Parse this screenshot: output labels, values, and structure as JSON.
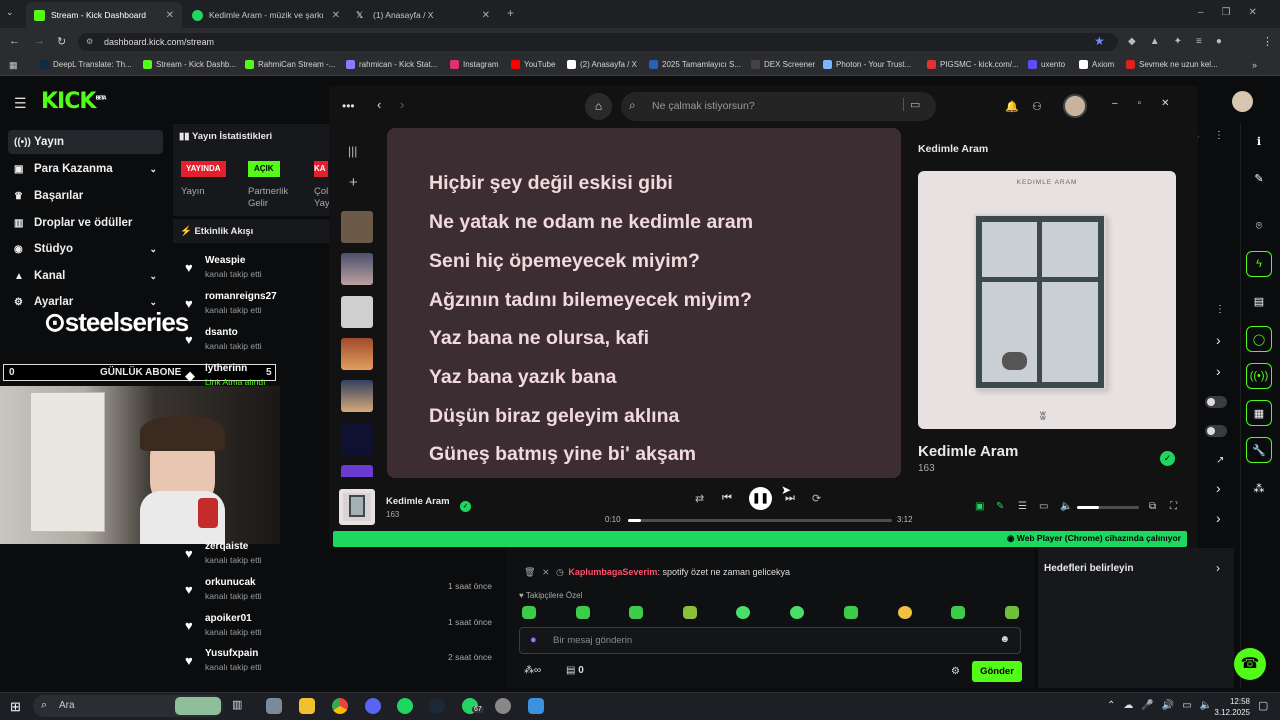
{
  "browser": {
    "tabs": [
      {
        "title": "Stream - Kick Dashboard",
        "color": "#53fc18"
      },
      {
        "title": "Kedimle Aram - müzik ve şarkı",
        "color": "#1ed760"
      },
      {
        "title": "(1) Anasayfa / X",
        "color": "#ffffff"
      }
    ],
    "url": "dashboard.kick.com/stream",
    "bookmarks": [
      "DeepL Translate: Th...",
      "Stream - Kick Dashb...",
      "RahmiCan Stream -...",
      "rahmican - Kick Stat...",
      "Instagram",
      "YouTube",
      "(2) Anasayfa / X",
      "2025 Tamamlayıcı S...",
      "DEX Screener",
      "Photon - Your Trust...",
      "PIGSMC - kick.com/...",
      "uxento",
      "Axiom",
      "Sevmek ne uzun kel..."
    ]
  },
  "kick": {
    "logo": "KICK",
    "logo_sup": "BETA",
    "sidebar": [
      {
        "label": "Yayın",
        "icon": "broadcast-icon"
      },
      {
        "label": "Para Kazanma",
        "icon": "money-icon"
      },
      {
        "label": "Başarılar",
        "icon": "trophy-icon"
      },
      {
        "label": "Droplar ve ödüller",
        "icon": "gift-icon"
      },
      {
        "label": "Stüdyo",
        "icon": "studio-icon"
      },
      {
        "label": "Kanal",
        "icon": "channel-icon"
      },
      {
        "label": "Ayarlar",
        "icon": "gear-icon"
      }
    ],
    "stats_title": "Yayın İstatistikleri",
    "stat_badges": [
      {
        "badge": "YAYINDA",
        "label": "Yayın",
        "color": "#e5202e"
      },
      {
        "badge": "AÇIK",
        "label": "Partnerlik Gelir",
        "color": "#53fc18"
      },
      {
        "badge": "KA",
        "label": "Çol Yay",
        "color": "#e5202e"
      }
    ],
    "activity_title": "Etkinlik Akışı",
    "feed": [
      {
        "name": "Weaspie",
        "sub": "kanalı takip etti",
        "time": ""
      },
      {
        "name": "romanreigns27",
        "sub": "kanalı takip etti",
        "time": ""
      },
      {
        "name": "dsanto",
        "sub": "kanalı takip etti",
        "time": ""
      },
      {
        "name": "lytherinn",
        "sub": "Link Atma alındı",
        "time": ""
      },
      {
        "name": "zerqaiste",
        "sub": "kanalı takip etti",
        "time": ""
      },
      {
        "name": "orkunucak",
        "sub": "kanalı takip etti",
        "time": "1 saat önce"
      },
      {
        "name": "apoiker01",
        "sub": "kanalı takip etti",
        "time": "1 saat önce"
      },
      {
        "name": "Yusufxpain",
        "sub": "kanalı takip etti",
        "time": "2 saat önce"
      }
    ],
    "overlay": {
      "brand": "steelseries",
      "counter_left": "0",
      "counter_label": "GÜNLÜK ABONE",
      "counter_right": "5"
    },
    "chat": {
      "msg_user": "KaplumbagaSeverim",
      "msg_text": ": spotify özet ne zaman gelicekya",
      "emote_label": "Takipçilere Özel",
      "input_placeholder": "Bir mesaj gönderin",
      "points": "0",
      "send": "Gönder"
    },
    "goals": "Hedefleri belirleyin"
  },
  "spotify": {
    "search_placeholder": "Ne çalmak istiyorsun?",
    "lyrics": [
      "Hiçbir şey değil eskisi gibi",
      "Ne yatak ne odam ne kedimle aram",
      "Seni hiç öpemeyecek miyim?",
      "Ağzının tadını bilemeyecek miyim?",
      "Yaz bana ne olursa, kafi",
      "Yaz bana yazık bana",
      "Düşün biraz geleyim aklına",
      "Güneş batmış yine bi' akşam"
    ],
    "panel_title": "Kedimle Aram",
    "cover_text": "KEDIMLE ARAM",
    "track_title": "Kedimle Aram",
    "track_artist": "163",
    "now_playing_title": "Kedimle Aram",
    "now_playing_artist": "163",
    "time_current": "0:10",
    "time_total": "3:12",
    "progress": 0.05,
    "volume": 0.35,
    "device_bar": "Web Player (Chrome) cihazında çalınıyor"
  },
  "taskbar": {
    "search": "Ara",
    "time": "12:58",
    "date": "3.12.2025",
    "badge": "67"
  }
}
